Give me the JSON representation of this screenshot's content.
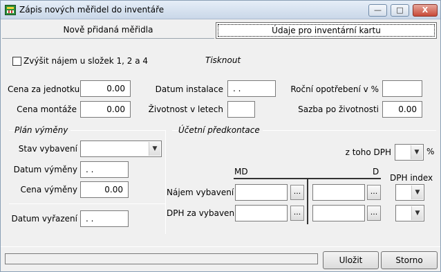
{
  "window": {
    "title": "Zápis nových měřidel do inventáře",
    "min_label": "—",
    "max_label": "□",
    "close_label": "X"
  },
  "tabs": [
    {
      "label": "Nově přidaná měřidla"
    },
    {
      "label": "Údaje pro inventární kartu"
    }
  ],
  "top": {
    "checkbox_label": "Zvýšit nájem u složek 1, 2 a 4",
    "print_label": "Tisknout"
  },
  "fields": {
    "cena_jednotku": {
      "label": "Cena za jednotku",
      "value": "0.00"
    },
    "cena_montaze": {
      "label": "Cena montáže",
      "value": "0.00"
    },
    "datum_instalace": {
      "label": "Datum instalace",
      "value": " .  . "
    },
    "zivotnost": {
      "label": "Životnost v letech",
      "value": ""
    },
    "rocni_opotrebeni": {
      "label": "Roční opotřebení v %",
      "value": ""
    },
    "sazba": {
      "label": "Sazba po životnosti",
      "value": "0.00"
    }
  },
  "plan": {
    "title": "Plán výměny",
    "stav": {
      "label": "Stav vybavení",
      "value": ""
    },
    "datum_vymeny": {
      "label": "Datum výměny",
      "value": " .  . "
    },
    "cena_vymeny": {
      "label": "Cena výměny",
      "value": "0.00"
    },
    "datum_vyrazeni": {
      "label": "Datum vyřazení",
      "value": " .  . "
    }
  },
  "ucetni": {
    "title": "Účetní předkontace",
    "z_toho_dph": {
      "label": "z toho DPH",
      "value": "",
      "unit": "%"
    },
    "md_label": "MD",
    "d_label": "D",
    "dph_index_label": "DPH index",
    "rows": [
      {
        "label": "Nájem vybavení",
        "md": "",
        "d": "",
        "index": ""
      },
      {
        "label": "DPH za vybavení",
        "md": "",
        "d": "",
        "index": ""
      }
    ],
    "ellipsis": "..."
  },
  "footer": {
    "save_label": "Uložit",
    "cancel_label": "Storno"
  }
}
